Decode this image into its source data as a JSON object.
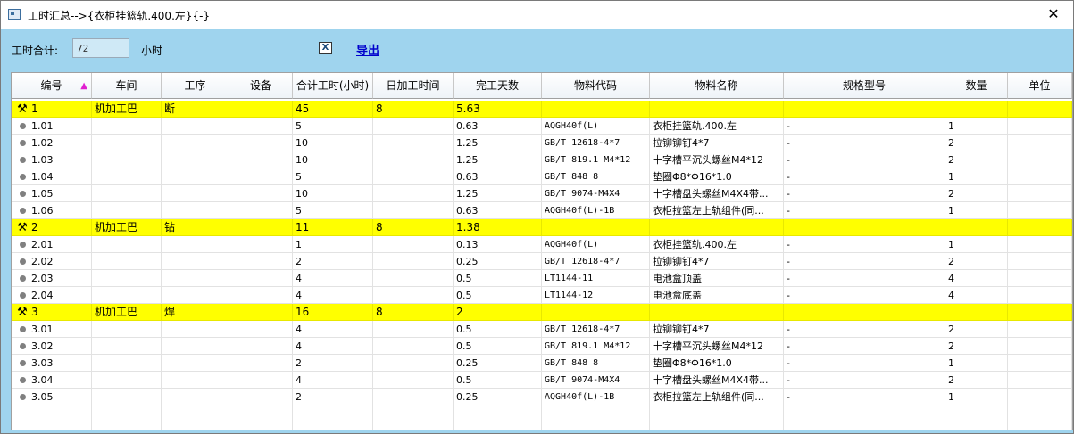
{
  "window": {
    "title": "工时汇总-->{衣柜挂篮轨.400.左}{-}",
    "close_glyph": "✕"
  },
  "toolbar": {
    "total_label": "工时合计:",
    "total_value": "72",
    "unit_label": "小时",
    "excel_icon": "X",
    "export_label": "导出"
  },
  "grid": {
    "columns": [
      "编号",
      "车间",
      "工序",
      "设备",
      "合计工时(小时)",
      "日加工时间",
      "完工天数",
      "物料代码",
      "物料名称",
      "规格型号",
      "数量",
      "单位"
    ],
    "sort_icon": "▲",
    "rows": [
      {
        "type": "parent",
        "no": "1",
        "workshop": "机加工巴",
        "process": "断",
        "equip": "",
        "hours": "45",
        "daily": "8",
        "days": "5.63",
        "code": "",
        "name": "",
        "spec": "",
        "qty": "",
        "unit": ""
      },
      {
        "type": "child",
        "no": "1.01",
        "workshop": "",
        "process": "",
        "equip": "",
        "hours": "5",
        "daily": "",
        "days": "0.63",
        "code": "AQGH40f(L)",
        "name": "衣柜挂篮轨.400.左",
        "spec": "-",
        "qty": "1",
        "unit": ""
      },
      {
        "type": "child",
        "no": "1.02",
        "workshop": "",
        "process": "",
        "equip": "",
        "hours": "10",
        "daily": "",
        "days": "1.25",
        "code": "GB/T 12618-4*7",
        "name": "拉铆铆钉4*7",
        "spec": "-",
        "qty": "2",
        "unit": ""
      },
      {
        "type": "child",
        "no": "1.03",
        "workshop": "",
        "process": "",
        "equip": "",
        "hours": "10",
        "daily": "",
        "days": "1.25",
        "code": "GB/T 819.1 M4*12",
        "name": "十字槽平沉头螺丝M4*12",
        "spec": "-",
        "qty": "2",
        "unit": ""
      },
      {
        "type": "child",
        "no": "1.04",
        "workshop": "",
        "process": "",
        "equip": "",
        "hours": "5",
        "daily": "",
        "days": "0.63",
        "code": "GB/T 848 8",
        "name": "垫圈Φ8*Φ16*1.0",
        "spec": "-",
        "qty": "1",
        "unit": ""
      },
      {
        "type": "child",
        "no": "1.05",
        "workshop": "",
        "process": "",
        "equip": "",
        "hours": "10",
        "daily": "",
        "days": "1.25",
        "code": "GB/T 9074-M4X4",
        "name": "十字槽盘头螺丝M4X4带...",
        "spec": "-",
        "qty": "2",
        "unit": ""
      },
      {
        "type": "child",
        "no": "1.06",
        "workshop": "",
        "process": "",
        "equip": "",
        "hours": "5",
        "daily": "",
        "days": "0.63",
        "code": "AQGH40f(L)-1B",
        "name": "衣柜拉篮左上轨组件(同...",
        "spec": "-",
        "qty": "1",
        "unit": ""
      },
      {
        "type": "parent",
        "no": "2",
        "workshop": "机加工巴",
        "process": "钻",
        "equip": "",
        "hours": "11",
        "daily": "8",
        "days": "1.38",
        "code": "",
        "name": "",
        "spec": "",
        "qty": "",
        "unit": ""
      },
      {
        "type": "child",
        "no": "2.01",
        "workshop": "",
        "process": "",
        "equip": "",
        "hours": "1",
        "daily": "",
        "days": "0.13",
        "code": "AQGH40f(L)",
        "name": "衣柜挂篮轨.400.左",
        "spec": "-",
        "qty": "1",
        "unit": ""
      },
      {
        "type": "child",
        "no": "2.02",
        "workshop": "",
        "process": "",
        "equip": "",
        "hours": "2",
        "daily": "",
        "days": "0.25",
        "code": "GB/T 12618-4*7",
        "name": "拉铆铆钉4*7",
        "spec": "-",
        "qty": "2",
        "unit": ""
      },
      {
        "type": "child",
        "no": "2.03",
        "workshop": "",
        "process": "",
        "equip": "",
        "hours": "4",
        "daily": "",
        "days": "0.5",
        "code": "LT1144-11",
        "name": "电池盒顶盖",
        "spec": "-",
        "qty": "4",
        "unit": ""
      },
      {
        "type": "child",
        "no": "2.04",
        "workshop": "",
        "process": "",
        "equip": "",
        "hours": "4",
        "daily": "",
        "days": "0.5",
        "code": "LT1144-12",
        "name": "电池盒底盖",
        "spec": "-",
        "qty": "4",
        "unit": ""
      },
      {
        "type": "parent",
        "no": "3",
        "workshop": "机加工巴",
        "process": "焊",
        "equip": "",
        "hours": "16",
        "daily": "8",
        "days": "2",
        "code": "",
        "name": "",
        "spec": "",
        "qty": "",
        "unit": ""
      },
      {
        "type": "child",
        "no": "3.01",
        "workshop": "",
        "process": "",
        "equip": "",
        "hours": "4",
        "daily": "",
        "days": "0.5",
        "code": "GB/T 12618-4*7",
        "name": "拉铆铆钉4*7",
        "spec": "-",
        "qty": "2",
        "unit": ""
      },
      {
        "type": "child",
        "no": "3.02",
        "workshop": "",
        "process": "",
        "equip": "",
        "hours": "4",
        "daily": "",
        "days": "0.5",
        "code": "GB/T 819.1 M4*12",
        "name": "十字槽平沉头螺丝M4*12",
        "spec": "-",
        "qty": "2",
        "unit": ""
      },
      {
        "type": "child",
        "no": "3.03",
        "workshop": "",
        "process": "",
        "equip": "",
        "hours": "2",
        "daily": "",
        "days": "0.25",
        "code": "GB/T 848 8",
        "name": "垫圈Φ8*Φ16*1.0",
        "spec": "-",
        "qty": "1",
        "unit": ""
      },
      {
        "type": "child",
        "no": "3.04",
        "workshop": "",
        "process": "",
        "equip": "",
        "hours": "4",
        "daily": "",
        "days": "0.5",
        "code": "GB/T 9074-M4X4",
        "name": "十字槽盘头螺丝M4X4带...",
        "spec": "-",
        "qty": "2",
        "unit": ""
      },
      {
        "type": "child",
        "no": "3.05",
        "workshop": "",
        "process": "",
        "equip": "",
        "hours": "2",
        "daily": "",
        "days": "0.25",
        "code": "AQGH40f(L)-1B",
        "name": "衣柜拉篮左上轨组件(同...",
        "spec": "-",
        "qty": "1",
        "unit": ""
      }
    ]
  }
}
